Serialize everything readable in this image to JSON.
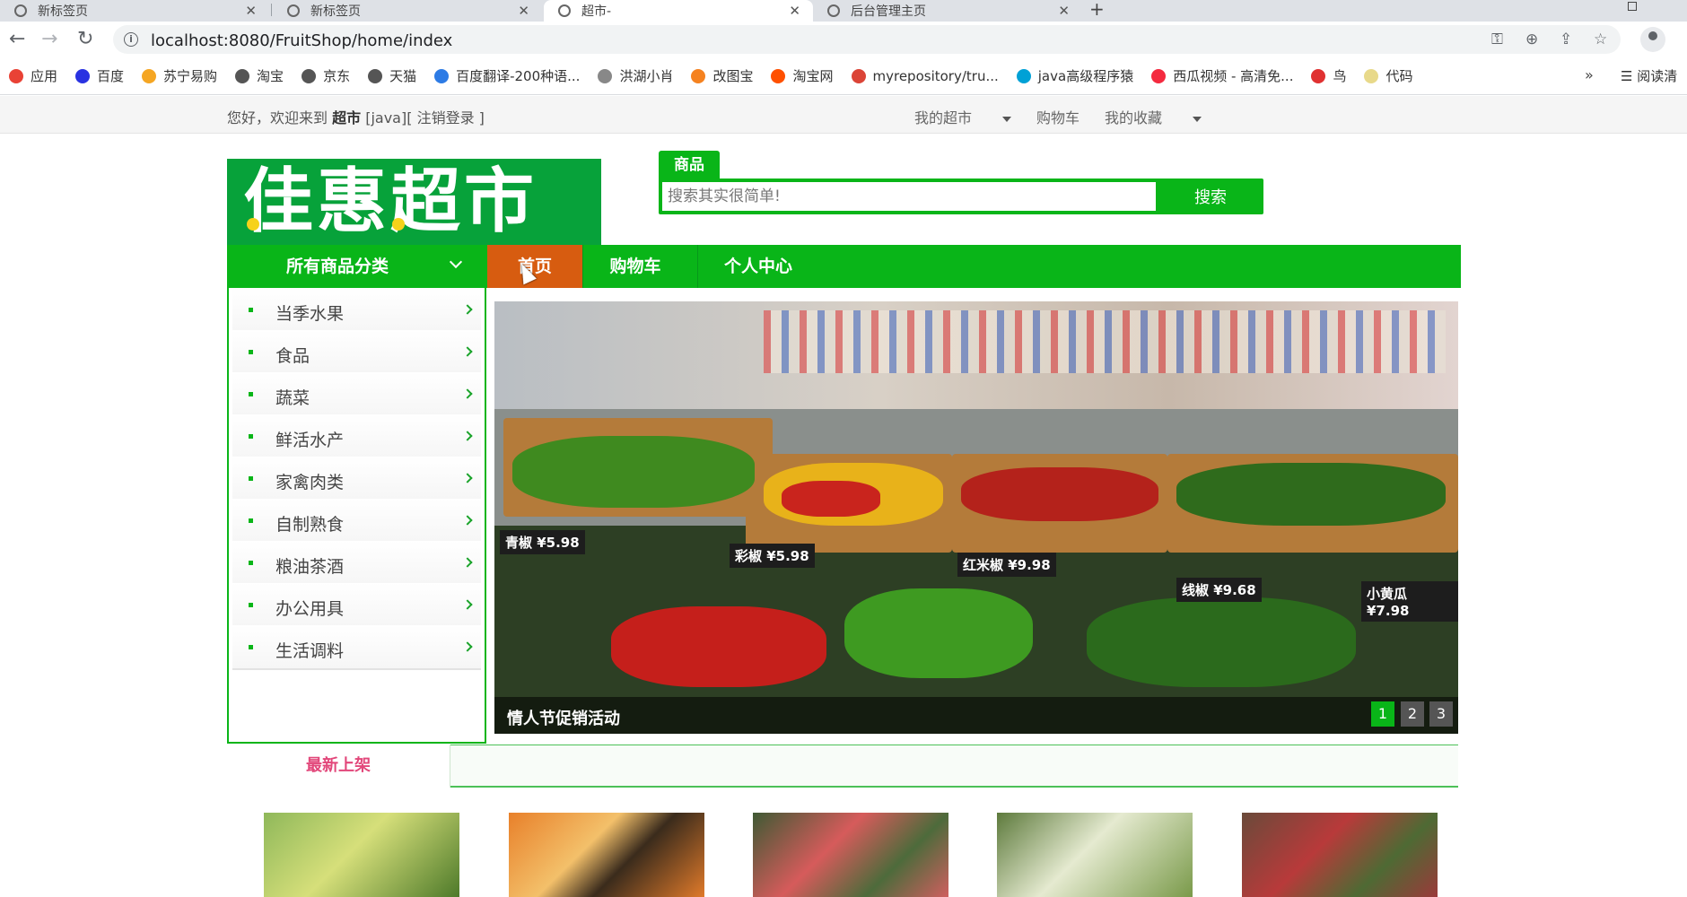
{
  "browser": {
    "tabs": [
      {
        "title": "新标签页"
      },
      {
        "title": "新标签页"
      },
      {
        "title": "超市-"
      },
      {
        "title": "后台管理主页"
      }
    ],
    "url": "localhost:8080/FruitShop/home/index",
    "bookmarks": [
      {
        "label": "应用",
        "color": "#e94235"
      },
      {
        "label": "百度",
        "color": "#2932e1"
      },
      {
        "label": "苏宁易购",
        "color": "#f5a623"
      },
      {
        "label": "淘宝",
        "color": "#555555"
      },
      {
        "label": "京东",
        "color": "#555555"
      },
      {
        "label": "天猫",
        "color": "#555555"
      },
      {
        "label": "百度翻译-200种语...",
        "color": "#2d7be5"
      },
      {
        "label": "洪湖小肖",
        "color": "#888888"
      },
      {
        "label": "改图宝",
        "color": "#f58220"
      },
      {
        "label": "淘宝网",
        "color": "#ff5000"
      },
      {
        "label": "myrepository/tru...",
        "color": "#db4437"
      },
      {
        "label": "java高级程序猿",
        "color": "#00a1d6"
      },
      {
        "label": "西瓜视频 - 高清免...",
        "color": "#f42a3f"
      },
      {
        "label": "鸟",
        "color": "#e03131"
      },
      {
        "label": "代码",
        "color": "#e8d98a"
      }
    ],
    "more_label": "»",
    "reading_list_label": "阅读清"
  },
  "site": {
    "welcome_prefix": "您好，欢迎来到",
    "site_name": "超市",
    "user": "[java]",
    "logout": "[ 注销登录 ]",
    "top_links": [
      "我的超市",
      "购物车",
      "我的收藏"
    ],
    "logo_text": "佳惠超市",
    "search": {
      "tab_label": "商品",
      "placeholder": "搜索其实很简单!",
      "button_label": "搜索"
    },
    "nav": {
      "all_categories": "所有商品分类",
      "items": [
        "首页",
        "购物车",
        "个人中心"
      ]
    },
    "categories": [
      "当季水果",
      "食品",
      "蔬菜",
      "鲜活水产",
      "家禽肉类",
      "自制熟食",
      "粮油茶酒",
      "办公用具",
      "生活调料"
    ],
    "banner": {
      "caption": "情人节促销活动",
      "price_tags": [
        "青椒 ¥5.98",
        "彩椒 ¥5.98",
        "红米椒 ¥9.98",
        "线椒 ¥9.68",
        "小黄瓜 ¥7.98"
      ],
      "pages": [
        "1",
        "2",
        "3"
      ],
      "active_page": "1"
    },
    "section_title": "最新上架",
    "colors": {
      "primary_green": "#09b518",
      "active_orange": "#d75c10",
      "section_pink": "#e2477a"
    }
  }
}
